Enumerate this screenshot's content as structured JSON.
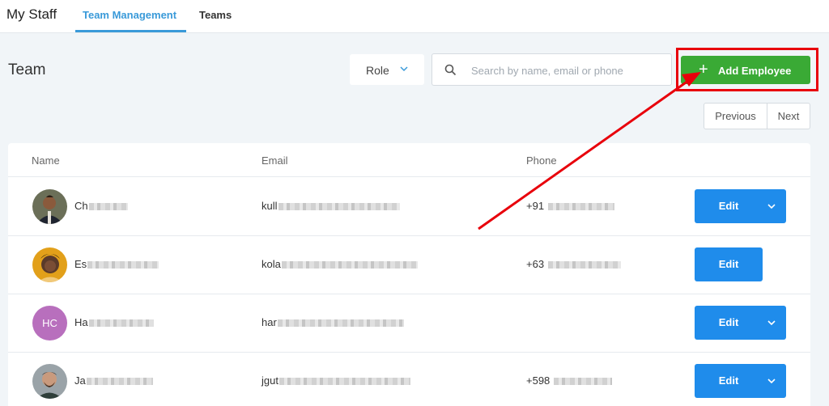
{
  "topbar": {
    "app_title": "My Staff",
    "tabs": [
      {
        "label": "Team Management",
        "active": true
      },
      {
        "label": "Teams",
        "active": false
      }
    ]
  },
  "header": {
    "title": "Team",
    "role_filter": {
      "label": "Role"
    },
    "search": {
      "placeholder": "Search by name, email or phone",
      "value": ""
    },
    "add_button": {
      "label": "Add Employee",
      "icon": "plus-icon"
    }
  },
  "pagination": {
    "previous": "Previous",
    "next": "Next"
  },
  "table": {
    "columns": [
      "Name",
      "Email",
      "Phone"
    ],
    "rows": [
      {
        "name": "Ch",
        "email": "kull",
        "phone": "+91",
        "avatar": "photo",
        "edit_label": "Edit",
        "edit_has_dropdown": true
      },
      {
        "name": "Es",
        "email": "kola",
        "phone": "+63",
        "avatar": "photo",
        "edit_label": "Edit",
        "edit_has_dropdown": false
      },
      {
        "name": "Ha",
        "email": "har",
        "phone": "",
        "avatar": "initials",
        "initials": "HC",
        "edit_label": "Edit",
        "edit_has_dropdown": true
      },
      {
        "name": "Ja",
        "email": "jgut",
        "phone": "+598",
        "avatar": "photo",
        "edit_label": "Edit",
        "edit_has_dropdown": true
      }
    ]
  },
  "colors": {
    "accent_blue": "#3a9ad9",
    "add_green": "#3aaa35",
    "edit_blue": "#1f8ceb",
    "annotation_red": "#e8000b",
    "avatar_purple": "#b86fbd"
  }
}
